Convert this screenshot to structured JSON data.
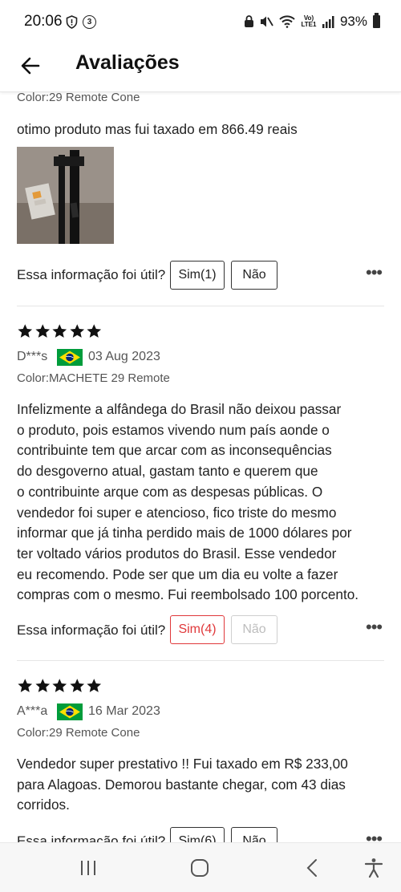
{
  "status_bar": {
    "time": "20:06",
    "battery": "93%",
    "left_icons": [
      "shield-icon",
      "badge-3-icon"
    ],
    "badge_number": "3",
    "right_icons": [
      "lock-icon",
      "mute-icon",
      "wifi-icon",
      "volte-icon",
      "signal-icon",
      "battery-icon"
    ],
    "volte_label": "Vo) LTE1"
  },
  "app_bar": {
    "title": "Avaliações"
  },
  "reviews": [
    {
      "color": "Color:29 Remote Cone",
      "text": "otimo produto mas fui taxado em 866.49 reais",
      "has_photo": true,
      "helpful_label": "Essa informação foi útil?",
      "yes_label": "Sim(1)",
      "no_label": "Não",
      "yes_state": "normal",
      "no_state": "normal"
    },
    {
      "stars": 5,
      "user": "D***s",
      "country": "Brasil",
      "date": "03 Aug 2023",
      "color": "Color:MACHETE 29 Remote",
      "text_lines": [
        "Infelizmente a alfândega do Brasil não deixou passar",
        "o produto, pois estamos vivendo num país aonde o",
        "contribuinte tem que arcar com as inconsequências",
        "do desgoverno atual, gastam tanto e querem que",
        "o contribuinte arque com as despesas públicas. O",
        "vendedor foi super e atencioso, fico triste do mesmo",
        "informar que já tinha perdido mais de 1000 dólares por",
        "ter voltado vários produtos do Brasil. Esse vendedor",
        "eu recomendo. Pode ser que um dia eu volte a fazer",
        "compras com o mesmo. Fui reembolsado 100 porcento."
      ],
      "helpful_label": "Essa informação foi útil?",
      "yes_label": "Sim(4)",
      "no_label": "Não",
      "yes_state": "selected",
      "no_state": "disabled"
    },
    {
      "stars": 5,
      "user": "A***a",
      "country": "Brasil",
      "date": "16 Mar 2023",
      "color": "Color:29 Remote Cone",
      "text_lines": [
        "Vendedor super prestativo !!  Fui taxado em R$ 233,00",
        "para Alagoas. Demorou bastante chegar, com 43 dias",
        "corridos."
      ],
      "helpful_label": "Essa informação foi útil?",
      "yes_label": "Sim(6)",
      "no_label": "Não"
    }
  ],
  "colors": {
    "accent_red": "#e0383a",
    "star": "#111111",
    "flag_green": "#009c3b",
    "flag_yellow": "#ffdf00",
    "flag_blue": "#002776"
  },
  "nav_bar": [
    "recent-apps-icon",
    "home-icon",
    "back-icon",
    "accessibility-icon"
  ]
}
